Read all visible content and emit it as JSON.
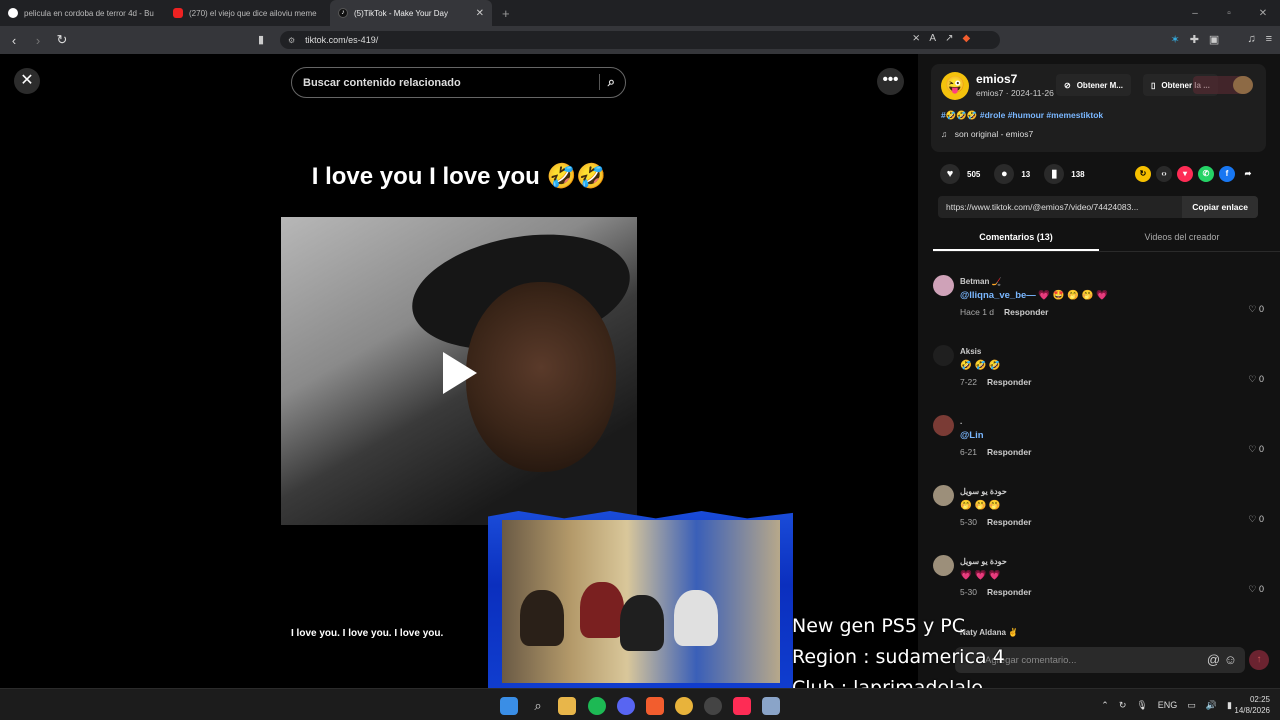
{
  "browser": {
    "tabs": [
      {
        "label": "pelicula en cordoba de terror 4d - Bu",
        "icon": "google-icon"
      },
      {
        "label": "(270) el viejo que dice ailoviu meme",
        "icon": "youtube-icon"
      },
      {
        "label": "(5)TikTok - Make Your Day",
        "icon": "tiktok-icon",
        "active": true
      }
    ],
    "url": "tiktok.com/es-419/"
  },
  "player": {
    "search_placeholder": "Buscar contenido relacionado",
    "caption": "I love you I love you 🤣🤣",
    "subtitle": "I love you. I love you. I love you."
  },
  "post": {
    "username": "emios7",
    "meta": "emios7 · 2024-11-26",
    "download_video": "Obtener M...",
    "download_app": "Obtener la ...",
    "tags": "#🤣🤣🤣 #drole #humour #memestiktok",
    "sound": "son original - emios7",
    "likes": "505",
    "comments": "13",
    "saves": "138",
    "link": "https://www.tiktok.com/@emios7/video/74424083...",
    "copy_label": "Copiar enlace"
  },
  "panel_tabs": {
    "comments": "Comentarios (13)",
    "creator_videos": "Videos del creador"
  },
  "comments": [
    {
      "name": "Вetman 🏒",
      "text": "@lliqna_ve_be— 💗 🤩 🤭 🤭 💗",
      "mention": true,
      "time": "Hace 1 d",
      "reply": "Responder",
      "likes": "0",
      "color": "#cfa2b8"
    },
    {
      "name": "Aksis",
      "text": "🤣 🤣 🤣",
      "mention": false,
      "time": "7-22",
      "reply": "Responder",
      "likes": "0",
      "color": "#1f1f1f"
    },
    {
      "name": ".",
      "text": "@Lin",
      "mention": true,
      "time": "6-21",
      "reply": "Responder",
      "likes": "0",
      "color": "#7a3b35"
    },
    {
      "name": "حودة يو سويل",
      "text": "🤭 🤭 🤭",
      "mention": false,
      "time": "5-30",
      "reply": "Responder",
      "likes": "0",
      "color": "#9c8f7a"
    },
    {
      "name": "حودة يو سويل",
      "text": "💗 💗 💗",
      "mention": false,
      "time": "5-30",
      "reply": "Responder",
      "likes": "0",
      "color": "#9c8f7a"
    }
  ],
  "next_commenter": "Naty Aldana ✌",
  "add_comment_placeholder": "Agregar comentario...",
  "stream_overlay": {
    "line1": "New gen PS5 y PC",
    "line2": "Region : sudamerica 4",
    "line3": "Club : laprimadelale"
  },
  "taskbar": {
    "lang": "ENG",
    "time": "02:25",
    "date": "14/8/2026"
  },
  "colors": {
    "accent": "#fe2c55",
    "link": "#7ab7ff",
    "overlay_blue": "#1a4cd9"
  }
}
